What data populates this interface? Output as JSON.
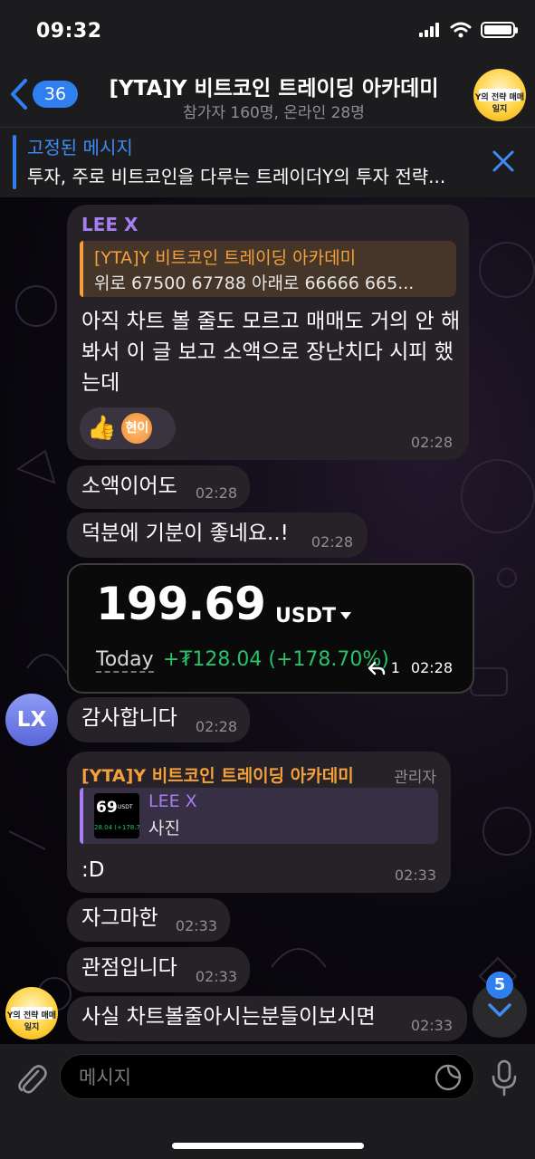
{
  "status_bar": {
    "time": "09:32"
  },
  "header": {
    "back_count": "36",
    "title": "[YTA]Y 비트코인 트레이딩 아카데미",
    "subtitle": "참가자 160명, 온라인 28명",
    "avatar_text": "Y의 전략 매매일지"
  },
  "pinned": {
    "title": "고정된 메시지",
    "text": "투자, 주로 비트코인을 다루는 트레이더Y의 투자 전략..."
  },
  "messages": {
    "m1": {
      "sender": "LEE X",
      "reply_title": "[YTA]Y 비트코인 트레이딩 아카데미",
      "reply_text": "위로 67500 67788 아래로 66666 665...",
      "text": "아직 차트 볼 줄도 모르고 매매도 거의 안 해봐서 이 글 보고 소액으로 장난치다 시피 했는데",
      "reaction_emoji": "👍",
      "reaction_avatar": "현이",
      "time": "02:28"
    },
    "m2": {
      "text": "소액이어도",
      "time": "02:28"
    },
    "m3": {
      "text": "덕분에 기분이 좋네요..!",
      "time": "02:28"
    },
    "m4": {
      "amount": "199.69",
      "unit": "USDT",
      "today_label": "Today",
      "gain": "+₮128.04 (+178.70%)",
      "replies": "1",
      "time": "02:28"
    },
    "m5": {
      "avatar": "LX",
      "text": "감사합니다",
      "time": "02:28"
    },
    "m6": {
      "sender": "[YTA]Y 비트코인 트레이딩 아카데미",
      "role": "관리자",
      "reply_title": "LEE X",
      "reply_text": "사진",
      "thumb_amount": "69",
      "thumb_unit": "USDT",
      "thumb_gain": "28.04 (+178.7",
      "text": ":D",
      "time": "02:33"
    },
    "m7": {
      "text": "자그마한",
      "time": "02:33"
    },
    "m8": {
      "text": "관점입니다",
      "time": "02:33"
    },
    "m9": {
      "avatar_text": "Y의 전략 매매일지",
      "text": "사실 차트볼줄아시는분들이보시면",
      "time": "02:33"
    }
  },
  "scroll": {
    "unread": "5"
  },
  "input": {
    "placeholder": "메시지"
  },
  "colors": {
    "accent": "#2f7ff1",
    "sender_purple": "#a67ef0",
    "sender_orange": "#f5a03a",
    "gain_green": "#27c26a",
    "bubble": "#262227"
  }
}
